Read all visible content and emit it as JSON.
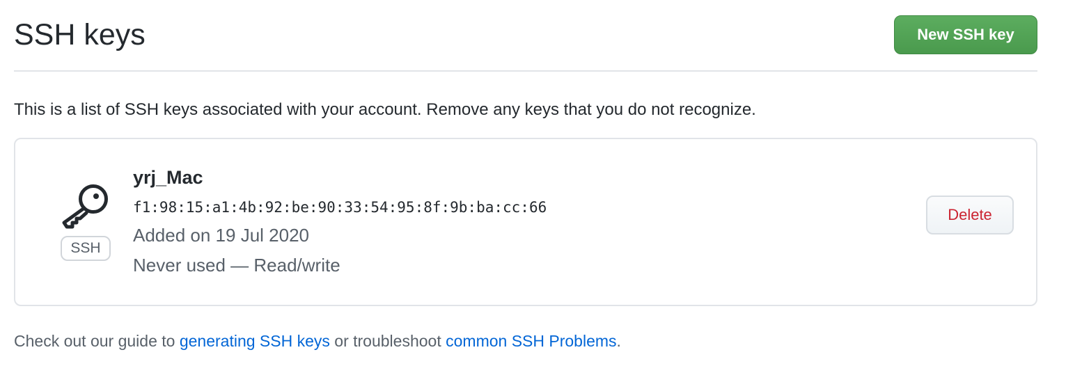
{
  "header": {
    "title": "SSH keys",
    "new_key_label": "New SSH key"
  },
  "intro": "This is a list of SSH keys associated with your account. Remove any keys that you do not recognize.",
  "keys": [
    {
      "title": "yrj_Mac",
      "fingerprint": "f1:98:15:a1:4b:92:be:90:33:54:95:8f:9b:ba:cc:66",
      "added": "Added on 19 Jul 2020",
      "usage": "Never used — Read/write",
      "type_badge": "SSH",
      "icon": "key-icon",
      "delete_label": "Delete"
    }
  ],
  "footer": {
    "prefix": "Check out our guide to ",
    "link1": "generating SSH keys",
    "middle": " or troubleshoot ",
    "link2": "common SSH Problems",
    "suffix": "."
  },
  "colors": {
    "primary_button": "#4e9f51",
    "danger_text": "#cb2431",
    "link": "#0366d6",
    "muted_text": "#586069",
    "border": "#e1e4e8"
  }
}
